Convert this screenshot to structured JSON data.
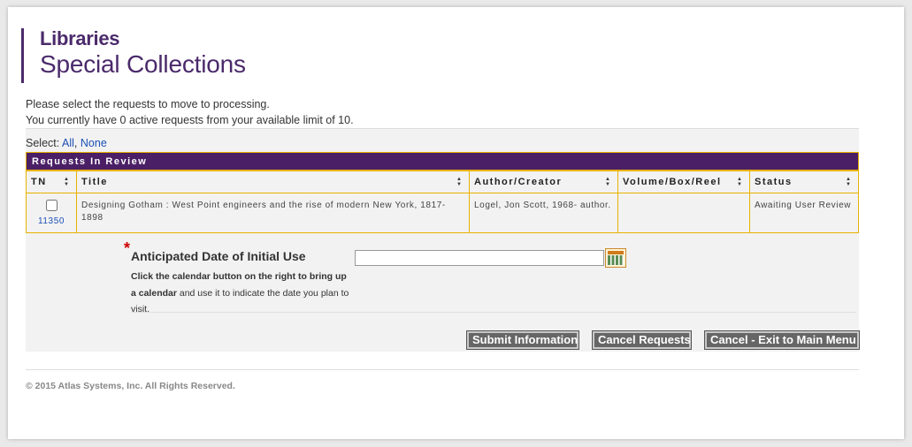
{
  "brand": {
    "line1": "Libraries",
    "line2": "Special Collections",
    "color": "#4b2a6b"
  },
  "intro": {
    "line1": "Please select the requests to move to processing.",
    "line2": "You currently have 0 active requests from your available limit of 10."
  },
  "select": {
    "label": "Select:",
    "all": "All",
    "sep": ",",
    "none": "None"
  },
  "requests": {
    "heading": "Requests In Review",
    "columns": [
      "TN",
      "Title",
      "Author/Creator",
      "Volume/Box/Reel",
      "Status"
    ],
    "sort_icon": "sort-both-icon",
    "rows": [
      {
        "tn": "11350",
        "title": "Designing Gotham : West Point engineers and the rise of modern New York, 1817-1898",
        "author": "Logel, Jon Scott, 1968- author.",
        "volume": "",
        "status": "Awaiting User Review"
      }
    ]
  },
  "form": {
    "required_mark": "*",
    "date_label": "Anticipated Date of Initial Use",
    "help_bold1": "Click the calendar button on the right to bring up a calendar",
    "help_normal": " and use it to indicate the date you plan to visit.",
    "date_value": "",
    "calendar_icon": "calendar-icon"
  },
  "buttons": {
    "submit": "Submit Information",
    "cancel_requests": "Cancel Requests",
    "cancel_exit": "Cancel - Exit to Main Menu"
  },
  "footer": "© 2015 Atlas Systems, Inc. All Rights Reserved.",
  "colors": {
    "header_bg": "#4b1f66",
    "table_border": "#e8b200",
    "link": "#1a4fb5",
    "button_bg": "#666666"
  }
}
